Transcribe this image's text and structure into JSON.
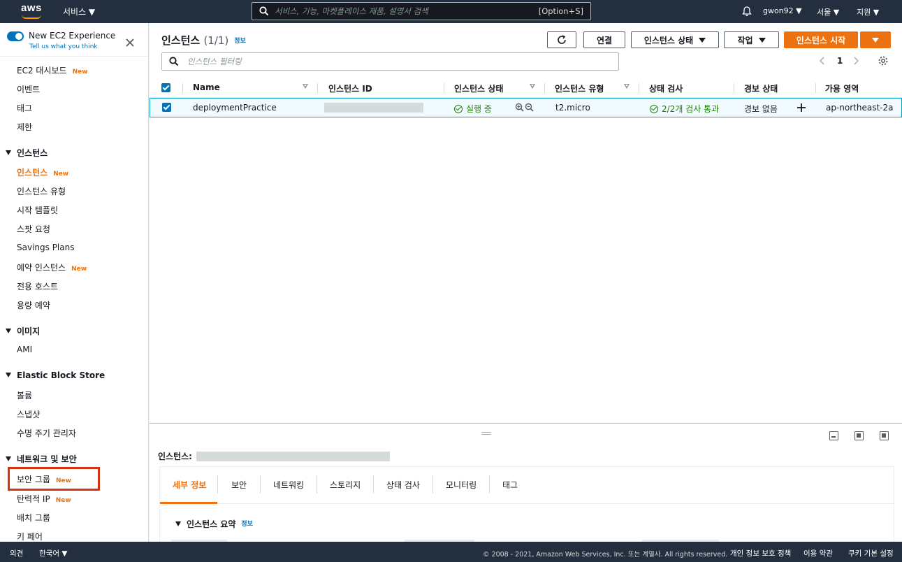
{
  "topnav": {
    "logo": "aws",
    "services": "서비스 ▼",
    "search_placeholder": "서비스, 기능, 마켓플레이스 제품, 설명서 검색",
    "search_shortcut": "[Option+S]",
    "user": "gwon92 ▼",
    "region": "서울 ▼",
    "support": "지원 ▼"
  },
  "sidebar": {
    "new_experience": "New EC2 Experience",
    "tell_us": "Tell us what you think",
    "new_badge": "New",
    "items": {
      "dashboard": "EC2 대시보드",
      "events": "이벤트",
      "tags": "태그",
      "limits": "제한",
      "sec_instances": "인스턴스",
      "instances": "인스턴스",
      "instance_types": "인스턴스 유형",
      "launch_templates": "시작 템플릿",
      "spot_requests": "스팟 요청",
      "savings_plans": "Savings Plans",
      "reserved_instances": "예약 인스턴스",
      "dedicated_hosts": "전용 호스트",
      "capacity_reservations": "용량 예약",
      "sec_images": "이미지",
      "ami": "AMI",
      "sec_ebs": "Elastic Block Store",
      "volumes": "볼륨",
      "snapshots": "스냅샷",
      "lifecycle_manager": "수명 주기 관리자",
      "sec_network": "네트워크 및 보안",
      "security_groups": "보안 그룹",
      "elastic_ips": "탄력적 IP",
      "placement_groups": "배치 그룹",
      "key_pairs": "키 페어"
    }
  },
  "main": {
    "title": "인스턴스",
    "count": "(1/1)",
    "info": "정보",
    "connect": "연결",
    "instance_state": "인스턴스 상태",
    "actions": "작업",
    "launch": "인스턴스 시작",
    "filter_placeholder": "인스턴스 필터링",
    "page": "1",
    "columns": {
      "name": "Name",
      "instance_id": "인스턴스 ID",
      "state": "인스턴스 상태",
      "type": "인스턴스 유형",
      "status_check": "상태 검사",
      "alarm": "경보 상태",
      "az": "가용 영역"
    },
    "row": {
      "name": "deploymentPractice",
      "state": "실행 중",
      "type": "t2.micro",
      "status_check": "2/2개 검사 통과",
      "alarm": "경보 없음",
      "az": "ap-northeast-2a"
    }
  },
  "split": {
    "title": "인스턴스:",
    "tabs": [
      "세부 정보",
      "보안",
      "네트워킹",
      "스토리지",
      "상태 검사",
      "모니터링",
      "태그"
    ],
    "summary": "인스턴스 요약",
    "info": "정보"
  },
  "footer": {
    "feedback": "의견",
    "language": "한국어 ▼",
    "copyright": "© 2008 - 2021, Amazon Web Services, Inc. 또는 계열사. All rights reserved.",
    "privacy": "개인 정보 보호 정책",
    "terms": "이용 약관",
    "cookies": "쿠키 기본 설정"
  }
}
